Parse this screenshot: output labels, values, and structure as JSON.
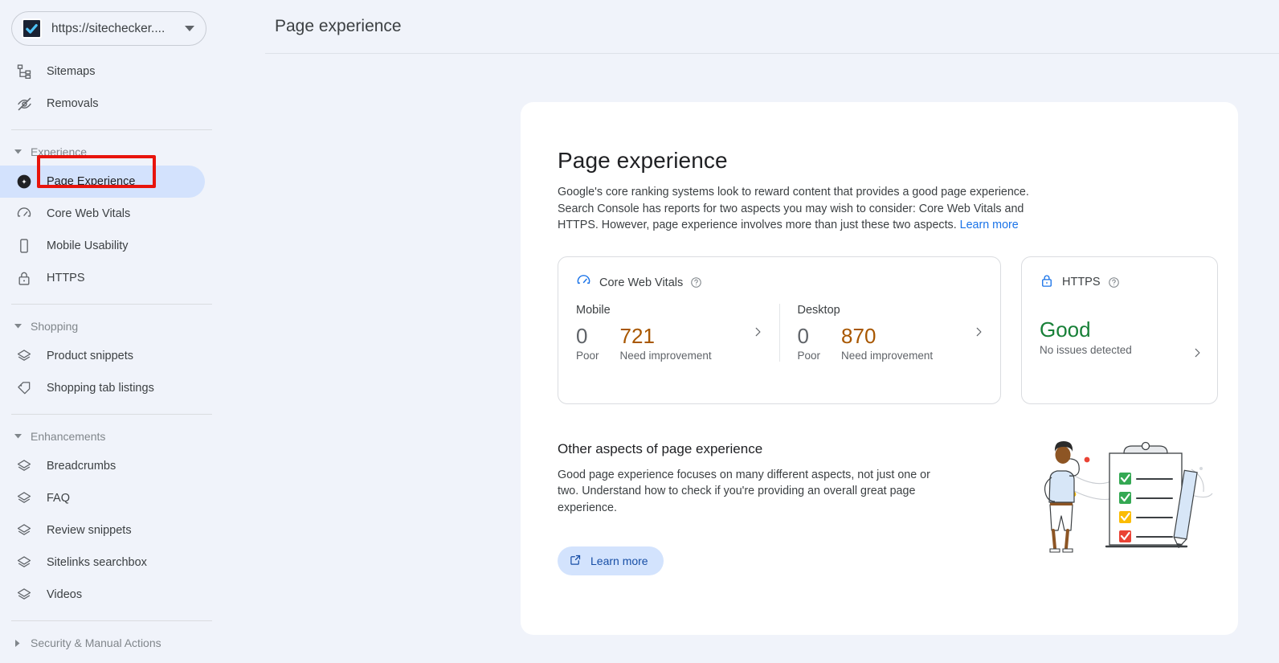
{
  "sidebar": {
    "property": {
      "value": "https://sitechecker....",
      "icon": "property-checkmark-icon",
      "caret_icon": "chevron-down-icon"
    },
    "top_items": [
      {
        "label": "Sitemaps",
        "icon": "sitemap-icon"
      },
      {
        "label": "Removals",
        "icon": "eye-off-icon"
      }
    ],
    "sections": [
      {
        "label": "Experience",
        "expanded": true,
        "caret_icon": "triangle-down-icon",
        "items": [
          {
            "label": "Page Experience",
            "icon": "page-experience-icon",
            "selected": true,
            "annotated": true
          },
          {
            "label": "Core Web Vitals",
            "icon": "speedometer-icon",
            "selected": false
          },
          {
            "label": "Mobile Usability",
            "icon": "mobile-phone-icon",
            "selected": false
          },
          {
            "label": "HTTPS",
            "icon": "lock-icon",
            "selected": false
          }
        ]
      },
      {
        "label": "Shopping",
        "expanded": true,
        "caret_icon": "triangle-down-icon",
        "items": [
          {
            "label": "Product snippets",
            "icon": "layers-icon",
            "selected": false
          },
          {
            "label": "Shopping tab listings",
            "icon": "tag-icon",
            "selected": false
          }
        ]
      },
      {
        "label": "Enhancements",
        "expanded": true,
        "caret_icon": "triangle-down-icon",
        "items": [
          {
            "label": "Breadcrumbs",
            "icon": "layers-icon",
            "selected": false
          },
          {
            "label": "FAQ",
            "icon": "layers-icon",
            "selected": false
          },
          {
            "label": "Review snippets",
            "icon": "layers-icon",
            "selected": false
          },
          {
            "label": "Sitelinks searchbox",
            "icon": "layers-icon",
            "selected": false
          },
          {
            "label": "Videos",
            "icon": "layers-icon",
            "selected": false
          }
        ]
      },
      {
        "label": "Security & Manual Actions",
        "expanded": false,
        "caret_icon": "triangle-right-icon",
        "items": []
      }
    ]
  },
  "header": {
    "title": "Page experience"
  },
  "main": {
    "title": "Page experience",
    "description": "Google's core ranking systems look to reward content that provides a good page experience. Search Console has reports for two aspects you may wish to consider: Core Web Vitals and HTTPS. However, page experience involves more than just these two aspects. ",
    "description_link": "Learn more",
    "core_web_vitals": {
      "label": "Core Web Vitals",
      "icon": "speedometer-icon",
      "help_icon": "help-circle-icon",
      "chevron_icon": "chevron-right-icon",
      "devices": [
        {
          "device": "Mobile",
          "poor_value": "0",
          "poor_label": "Poor",
          "needs_improvement_value": "721",
          "needs_improvement_label": "Need improvement"
        },
        {
          "device": "Desktop",
          "poor_value": "0",
          "poor_label": "Poor",
          "needs_improvement_value": "870",
          "needs_improvement_label": "Need improvement"
        }
      ]
    },
    "https": {
      "label": "HTTPS",
      "icon": "lock-icon",
      "help_icon": "help-circle-icon",
      "chevron_icon": "chevron-right-icon",
      "status": "Good",
      "status_detail": "No issues detected"
    },
    "other_aspects": {
      "title": "Other aspects of page experience",
      "description": "Good page experience focuses on many different aspects, not just one or two. Understand how to check if you're providing an overall great page experience.",
      "button_label": "Learn more",
      "button_icon": "external-link-icon",
      "illustration": "person-with-checklist-illustration"
    }
  },
  "colors": {
    "background": "#f0f3fa",
    "card": "#ffffff",
    "accent_blue": "#1a73e8",
    "selected_nav": "#d3e2fd",
    "needs_improvement": "#a85700",
    "good_green": "#188038",
    "annotation_red": "#e8140c"
  }
}
